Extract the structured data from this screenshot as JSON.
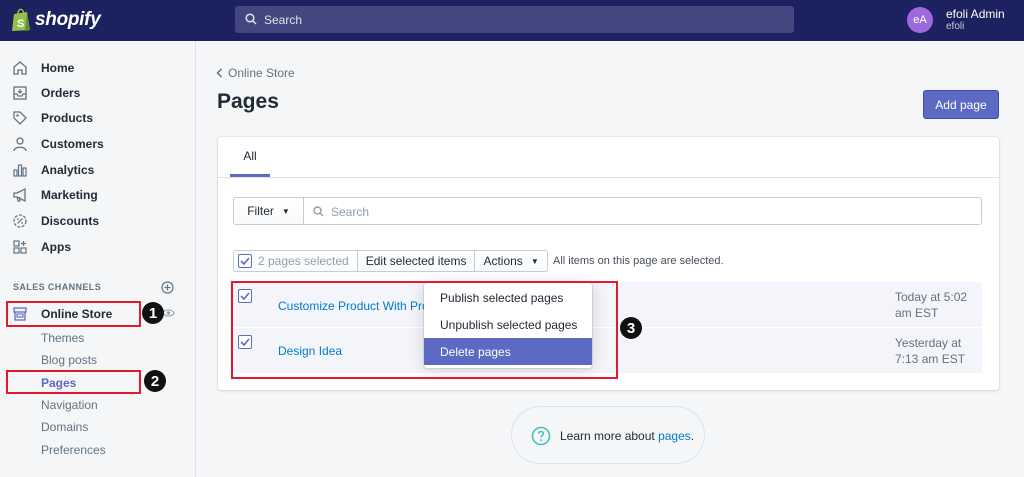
{
  "topbar": {
    "brand": "shopify",
    "search_placeholder": "Search",
    "avatar_initials": "eA",
    "user_name": "efoli Admin",
    "store_name": "efoli"
  },
  "sidebar": {
    "items": [
      {
        "label": "Home",
        "icon": "home-icon"
      },
      {
        "label": "Orders",
        "icon": "orders-icon"
      },
      {
        "label": "Products",
        "icon": "tag-icon"
      },
      {
        "label": "Customers",
        "icon": "person-icon"
      },
      {
        "label": "Analytics",
        "icon": "bar-chart-icon"
      },
      {
        "label": "Marketing",
        "icon": "megaphone-icon"
      },
      {
        "label": "Discounts",
        "icon": "discount-icon"
      },
      {
        "label": "Apps",
        "icon": "apps-icon"
      }
    ],
    "section_heading": "SALES CHANNELS",
    "channel": "Online Store",
    "sub_items": [
      "Themes",
      "Blog posts",
      "Pages",
      "Navigation",
      "Domains",
      "Preferences"
    ]
  },
  "main": {
    "breadcrumb": "Online Store",
    "title": "Pages",
    "add_button": "Add page",
    "tab_all": "All",
    "filter_label": "Filter",
    "search_placeholder": "Search",
    "bulk": {
      "selected_count": "2 pages selected",
      "edit_label": "Edit selected items",
      "actions_label": "Actions",
      "note": "All items on this page are selected."
    },
    "rows": [
      {
        "title": "Customize Product With Pro",
        "date_line1": "Today at 5:02",
        "date_line2": "am EST"
      },
      {
        "title": "Design Idea",
        "date_line1": "Yesterday at",
        "date_line2": "7:13 am EST"
      }
    ],
    "dropdown": [
      "Publish selected pages",
      "Unpublish selected pages",
      "Delete pages"
    ],
    "help_text": "Learn more about ",
    "help_link": "pages",
    "help_period": "."
  },
  "annotations": {
    "markers": [
      "1",
      "2",
      "3"
    ],
    "box_color": "#e21b2c"
  },
  "colors": {
    "topbar": "#1c2260",
    "accent": "#5c6ac4",
    "link": "#007ace"
  }
}
